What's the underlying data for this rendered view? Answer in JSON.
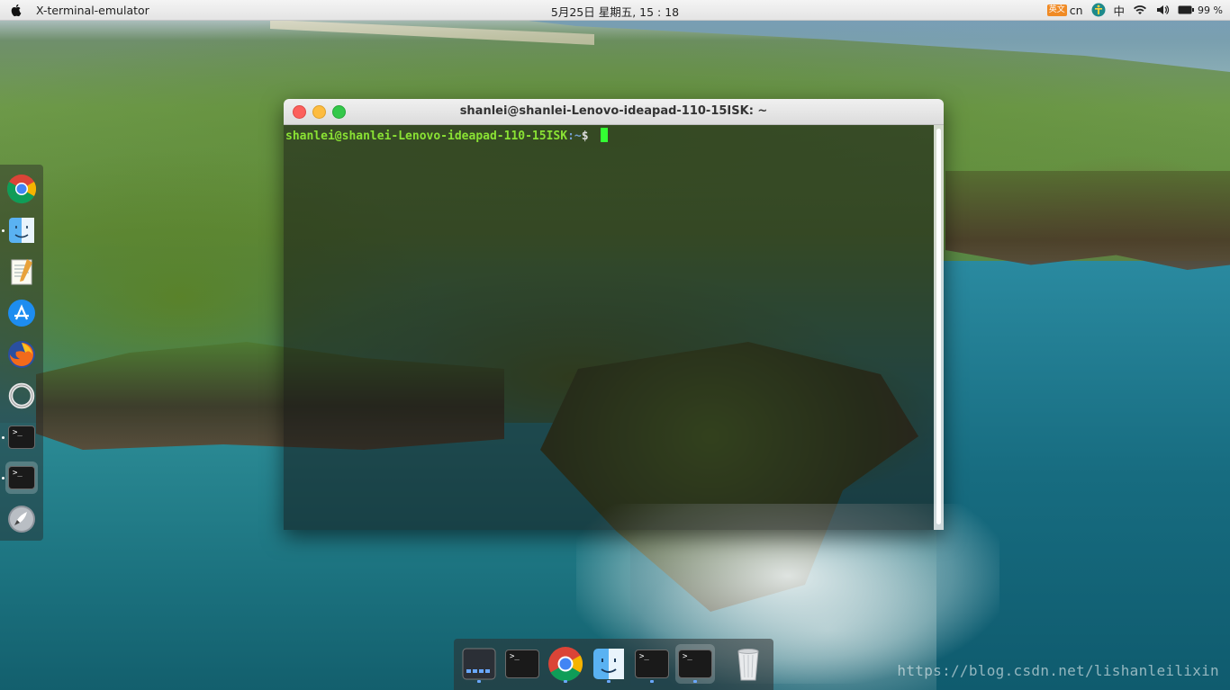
{
  "topbar": {
    "app_title": "X-terminal-emulator",
    "clock": "5月25日 星期五, 15 : 18",
    "ime_badge": "英文",
    "ime_lang": "cn",
    "input_method": "中",
    "battery": "99 %"
  },
  "terminal": {
    "title": "shanlei@shanlei-Lenovo-ideapad-110-15ISK: ~",
    "prompt_user": "shanlei@shanlei-Lenovo-ideapad-110-15ISK",
    "prompt_path": ":~",
    "prompt_suffix": "$ "
  },
  "left_dock": {
    "items": [
      {
        "name": "chrome"
      },
      {
        "name": "finder"
      },
      {
        "name": "text-editor"
      },
      {
        "name": "app-store"
      },
      {
        "name": "firefox"
      },
      {
        "name": "system-settings"
      },
      {
        "name": "terminal"
      },
      {
        "name": "terminal"
      },
      {
        "name": "launchpad"
      }
    ]
  },
  "bottom_dock": {
    "items": [
      {
        "name": "dock-preview"
      },
      {
        "name": "terminal"
      },
      {
        "name": "chrome"
      },
      {
        "name": "finder"
      },
      {
        "name": "terminal"
      },
      {
        "name": "terminal"
      },
      {
        "name": "trash"
      }
    ]
  },
  "watermark": "https://blog.csdn.net/lishanleilixin",
  "colors": {
    "prompt_green": "#8ae234",
    "prompt_blue": "#729fcf",
    "cursor": "#33ff33",
    "close": "#fc605c",
    "minimize": "#fdbc40",
    "maximize": "#34c84a"
  }
}
